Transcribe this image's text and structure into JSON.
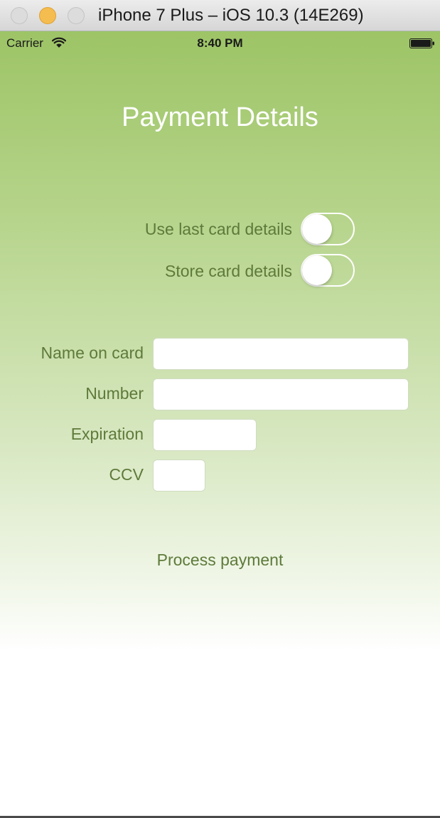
{
  "window": {
    "title": "iPhone 7 Plus – iOS 10.3 (14E269)"
  },
  "status_bar": {
    "carrier": "Carrier",
    "time": "8:40 PM",
    "icons": [
      "wifi-icon",
      "battery-icon"
    ]
  },
  "page": {
    "title": "Payment Details"
  },
  "switches": [
    {
      "label": "Use last card details",
      "on": false
    },
    {
      "label": "Store card details",
      "on": false
    }
  ],
  "form": {
    "fields": [
      {
        "label": "Name on card",
        "value": "",
        "placeholder": ""
      },
      {
        "label": "Number",
        "value": "",
        "placeholder": ""
      },
      {
        "label": "Expiration",
        "value": "",
        "placeholder": ""
      },
      {
        "label": "CCV",
        "value": "",
        "placeholder": ""
      }
    ],
    "submit_label": "Process payment"
  },
  "colors": {
    "gradient_top": "#9dc466",
    "label_text": "#5e7a3a",
    "title_text": "#ffffff"
  }
}
